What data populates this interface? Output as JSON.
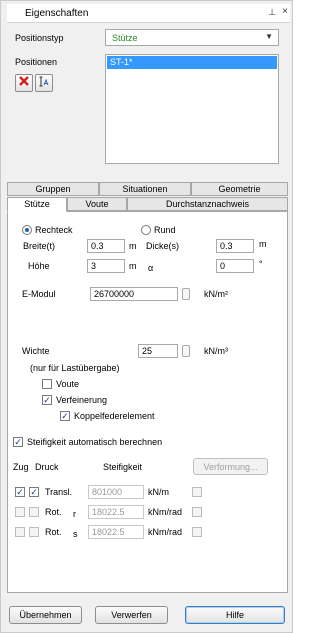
{
  "window": {
    "title": "Eigenschaften",
    "pin_glyph": "⊥",
    "close_glyph": "×"
  },
  "positionstyp": {
    "label": "Positionstyp",
    "value": "Stütze"
  },
  "positionen": {
    "label": "Positionen",
    "selected": "ST-1*"
  },
  "tabs_top": [
    "Gruppen",
    "Situationen",
    "Geometrie"
  ],
  "tabs_bottom": [
    "Stütze",
    "Voute",
    "Durchstanznachweis"
  ],
  "form": {
    "rechteck": "Rechteck",
    "rund": "Rund",
    "breite_label": "Breite(t)",
    "breite_value": "0.3",
    "breite_unit": "m",
    "dicke_label": "Dicke(s)",
    "dicke_value": "0.3",
    "dicke_unit": "m",
    "hoehe_label": "Höhe",
    "hoehe_value": "3",
    "hoehe_unit": "m",
    "alpha_label": "α",
    "alpha_value": "0",
    "alpha_unit": "°",
    "emodul_label": "E-Modul",
    "emodul_value": "26700000",
    "emodul_unit": "kN/m²",
    "wichte_label": "Wichte",
    "wichte_value": "25",
    "wichte_unit": "kN/m³",
    "note": "(nur für Lastübergabe)",
    "voute": "Voute",
    "verfeinerung": "Verfeinerung",
    "koppel": "Koppelfederelement",
    "auto": "Steifigkeit automatisch berechnen"
  },
  "springs": {
    "header_zug": "Zug",
    "header_druck": "Druck",
    "header_steif": "Steifigkeit",
    "verformung_button": "Verformung...",
    "rows": [
      {
        "label": "Transl.",
        "sub": "",
        "value": "801000",
        "unit": "kN/m"
      },
      {
        "label": "Rot.",
        "sub": "r",
        "value": "18022.5",
        "unit": "kNm/rad"
      },
      {
        "label": "Rot.",
        "sub": "s",
        "value": "18022.5",
        "unit": "kNm/rad"
      }
    ]
  },
  "buttons": {
    "uebernehmen": "Übernehmen",
    "verwerfen": "Verwerfen",
    "hilfe": "Hilfe"
  },
  "colors": {
    "selection": "#3399ff",
    "positionstyp_text": "#2a8a2a"
  }
}
